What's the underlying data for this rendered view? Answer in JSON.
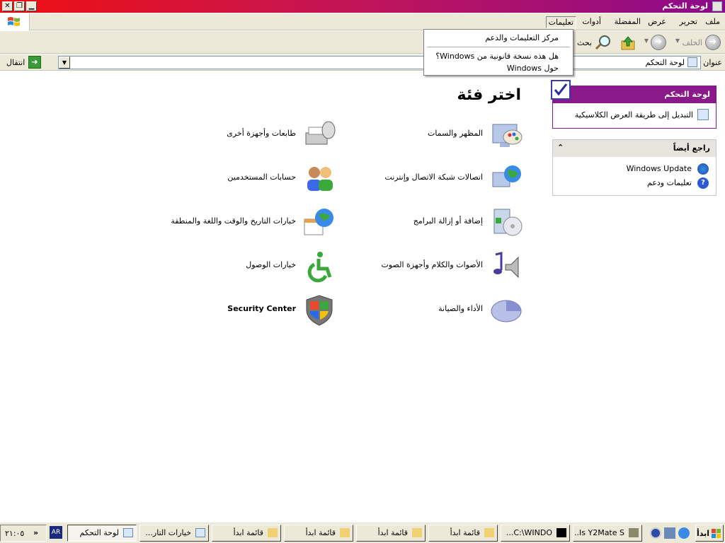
{
  "window": {
    "title": "لوحة التحكم",
    "buttons": {
      "close": "✕",
      "restore": "❐",
      "minimize": "▁"
    }
  },
  "menubar": {
    "items": [
      "ملف",
      "تحرير",
      "عرض",
      "المفضلة",
      "أدوات",
      "تعليمات"
    ]
  },
  "toolbar": {
    "back_label": "الخلف",
    "search_label": "بحث"
  },
  "address": {
    "label": "عنوان",
    "value": "لوحة التحكم",
    "go_label": "انتقال"
  },
  "help_menu": {
    "items": [
      "مركز التعليمات والدعم",
      "هل هذه نسخة قانونية من Windows؟",
      "حول Windows"
    ]
  },
  "task_pane": {
    "control_panel": {
      "title": "لوحة التحكم",
      "link": "التبديل إلى طريقة العرض الكلاسيكية"
    },
    "see_also": {
      "title": "راجع أيضاً",
      "links": [
        "Windows Update",
        "تعليمات ودعم"
      ]
    }
  },
  "main": {
    "heading": "اختر فئة",
    "categories": [
      {
        "label": "المظهر والسمات",
        "icon": "appearance-icon"
      },
      {
        "label": "طابعات وأجهزة أخرى",
        "icon": "printer-icon"
      },
      {
        "label": "اتصالات شبكة الاتصال وإنترنت",
        "icon": "network-icon"
      },
      {
        "label": "حسابات المستخدمين",
        "icon": "users-icon"
      },
      {
        "label": "إضافة أو إزالة البرامج",
        "icon": "programs-icon"
      },
      {
        "label": "خيارات التاريخ والوقت واللغة والمنطقة",
        "icon": "datetime-icon"
      },
      {
        "label": "الأصوات والكلام وأجهزة الصوت",
        "icon": "sound-icon"
      },
      {
        "label": "خيارات الوصول",
        "icon": "accessibility-icon"
      },
      {
        "label": "الأداء والصيانة",
        "icon": "performance-icon"
      },
      {
        "label": "Security Center",
        "icon": "shield-icon"
      }
    ]
  },
  "taskbar": {
    "start_label": "ابدأ",
    "buttons": [
      "Is Y2Mate S...",
      "C:\\WINDO...",
      "قائمة ابدأ",
      "قائمة ابدأ",
      "قائمة ابدأ",
      "قائمة ابدأ",
      "خيارات التار...",
      "لوحة التحكم"
    ],
    "language": "AR",
    "chevron": "«",
    "clock": "٢١:٠٥"
  }
}
